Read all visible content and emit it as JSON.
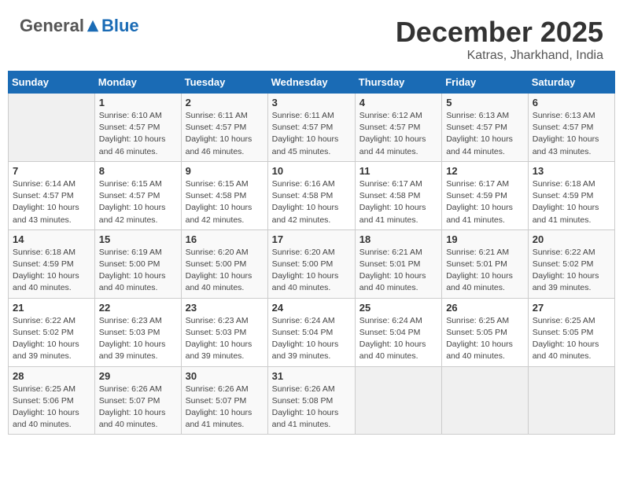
{
  "logo": {
    "general": "General",
    "blue": "Blue"
  },
  "title": "December 2025",
  "location": "Katras, Jharkhand, India",
  "weekdays": [
    "Sunday",
    "Monday",
    "Tuesday",
    "Wednesday",
    "Thursday",
    "Friday",
    "Saturday"
  ],
  "weeks": [
    [
      {
        "day": "",
        "info": ""
      },
      {
        "day": "1",
        "info": "Sunrise: 6:10 AM\nSunset: 4:57 PM\nDaylight: 10 hours\nand 46 minutes."
      },
      {
        "day": "2",
        "info": "Sunrise: 6:11 AM\nSunset: 4:57 PM\nDaylight: 10 hours\nand 46 minutes."
      },
      {
        "day": "3",
        "info": "Sunrise: 6:11 AM\nSunset: 4:57 PM\nDaylight: 10 hours\nand 45 minutes."
      },
      {
        "day": "4",
        "info": "Sunrise: 6:12 AM\nSunset: 4:57 PM\nDaylight: 10 hours\nand 44 minutes."
      },
      {
        "day": "5",
        "info": "Sunrise: 6:13 AM\nSunset: 4:57 PM\nDaylight: 10 hours\nand 44 minutes."
      },
      {
        "day": "6",
        "info": "Sunrise: 6:13 AM\nSunset: 4:57 PM\nDaylight: 10 hours\nand 43 minutes."
      }
    ],
    [
      {
        "day": "7",
        "info": "Sunrise: 6:14 AM\nSunset: 4:57 PM\nDaylight: 10 hours\nand 43 minutes."
      },
      {
        "day": "8",
        "info": "Sunrise: 6:15 AM\nSunset: 4:57 PM\nDaylight: 10 hours\nand 42 minutes."
      },
      {
        "day": "9",
        "info": "Sunrise: 6:15 AM\nSunset: 4:58 PM\nDaylight: 10 hours\nand 42 minutes."
      },
      {
        "day": "10",
        "info": "Sunrise: 6:16 AM\nSunset: 4:58 PM\nDaylight: 10 hours\nand 42 minutes."
      },
      {
        "day": "11",
        "info": "Sunrise: 6:17 AM\nSunset: 4:58 PM\nDaylight: 10 hours\nand 41 minutes."
      },
      {
        "day": "12",
        "info": "Sunrise: 6:17 AM\nSunset: 4:59 PM\nDaylight: 10 hours\nand 41 minutes."
      },
      {
        "day": "13",
        "info": "Sunrise: 6:18 AM\nSunset: 4:59 PM\nDaylight: 10 hours\nand 41 minutes."
      }
    ],
    [
      {
        "day": "14",
        "info": "Sunrise: 6:18 AM\nSunset: 4:59 PM\nDaylight: 10 hours\nand 40 minutes."
      },
      {
        "day": "15",
        "info": "Sunrise: 6:19 AM\nSunset: 5:00 PM\nDaylight: 10 hours\nand 40 minutes."
      },
      {
        "day": "16",
        "info": "Sunrise: 6:20 AM\nSunset: 5:00 PM\nDaylight: 10 hours\nand 40 minutes."
      },
      {
        "day": "17",
        "info": "Sunrise: 6:20 AM\nSunset: 5:00 PM\nDaylight: 10 hours\nand 40 minutes."
      },
      {
        "day": "18",
        "info": "Sunrise: 6:21 AM\nSunset: 5:01 PM\nDaylight: 10 hours\nand 40 minutes."
      },
      {
        "day": "19",
        "info": "Sunrise: 6:21 AM\nSunset: 5:01 PM\nDaylight: 10 hours\nand 40 minutes."
      },
      {
        "day": "20",
        "info": "Sunrise: 6:22 AM\nSunset: 5:02 PM\nDaylight: 10 hours\nand 39 minutes."
      }
    ],
    [
      {
        "day": "21",
        "info": "Sunrise: 6:22 AM\nSunset: 5:02 PM\nDaylight: 10 hours\nand 39 minutes."
      },
      {
        "day": "22",
        "info": "Sunrise: 6:23 AM\nSunset: 5:03 PM\nDaylight: 10 hours\nand 39 minutes."
      },
      {
        "day": "23",
        "info": "Sunrise: 6:23 AM\nSunset: 5:03 PM\nDaylight: 10 hours\nand 39 minutes."
      },
      {
        "day": "24",
        "info": "Sunrise: 6:24 AM\nSunset: 5:04 PM\nDaylight: 10 hours\nand 39 minutes."
      },
      {
        "day": "25",
        "info": "Sunrise: 6:24 AM\nSunset: 5:04 PM\nDaylight: 10 hours\nand 40 minutes."
      },
      {
        "day": "26",
        "info": "Sunrise: 6:25 AM\nSunset: 5:05 PM\nDaylight: 10 hours\nand 40 minutes."
      },
      {
        "day": "27",
        "info": "Sunrise: 6:25 AM\nSunset: 5:05 PM\nDaylight: 10 hours\nand 40 minutes."
      }
    ],
    [
      {
        "day": "28",
        "info": "Sunrise: 6:25 AM\nSunset: 5:06 PM\nDaylight: 10 hours\nand 40 minutes."
      },
      {
        "day": "29",
        "info": "Sunrise: 6:26 AM\nSunset: 5:07 PM\nDaylight: 10 hours\nand 40 minutes."
      },
      {
        "day": "30",
        "info": "Sunrise: 6:26 AM\nSunset: 5:07 PM\nDaylight: 10 hours\nand 41 minutes."
      },
      {
        "day": "31",
        "info": "Sunrise: 6:26 AM\nSunset: 5:08 PM\nDaylight: 10 hours\nand 41 minutes."
      },
      {
        "day": "",
        "info": ""
      },
      {
        "day": "",
        "info": ""
      },
      {
        "day": "",
        "info": ""
      }
    ]
  ]
}
